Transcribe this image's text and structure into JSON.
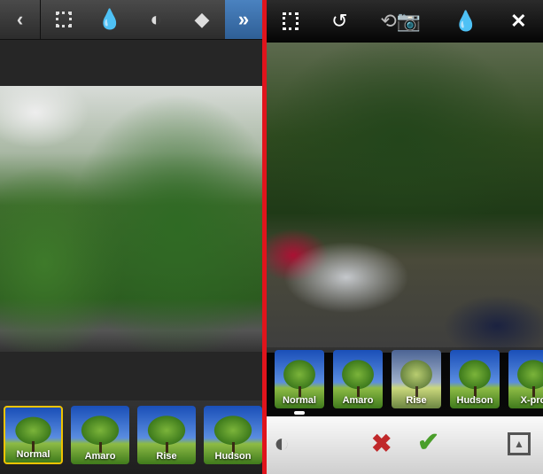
{
  "left_panel": {
    "toolbar": {
      "back_icon": "chevron-left",
      "icons": [
        "border-frame",
        "tilt-shift-drop",
        "brightness-lux",
        "rotate"
      ],
      "forward_icon": "double-chevron-right",
      "accent": "#3a6fa8"
    },
    "filters": [
      {
        "label": "Normal",
        "selected": true
      },
      {
        "label": "Amaro"
      },
      {
        "label": "Rise"
      },
      {
        "label": "Hudson"
      }
    ]
  },
  "divider_color": "#e0141c",
  "right_panel": {
    "toolbar": {
      "icons": [
        "border-frame",
        "rotate",
        "flip-camera",
        "tilt-shift-drop",
        "close"
      ]
    },
    "filters": [
      {
        "label": "Normal",
        "selected": true
      },
      {
        "label": "Amaro"
      },
      {
        "label": "Rise"
      },
      {
        "label": "Hudson"
      },
      {
        "label": "X-pro"
      }
    ],
    "bottom_bar": {
      "icons": [
        "brightness-lux",
        "cancel",
        "confirm",
        "expand-up"
      ],
      "cancel_color": "#c0282a",
      "confirm_color": "#4a9e2a"
    }
  }
}
